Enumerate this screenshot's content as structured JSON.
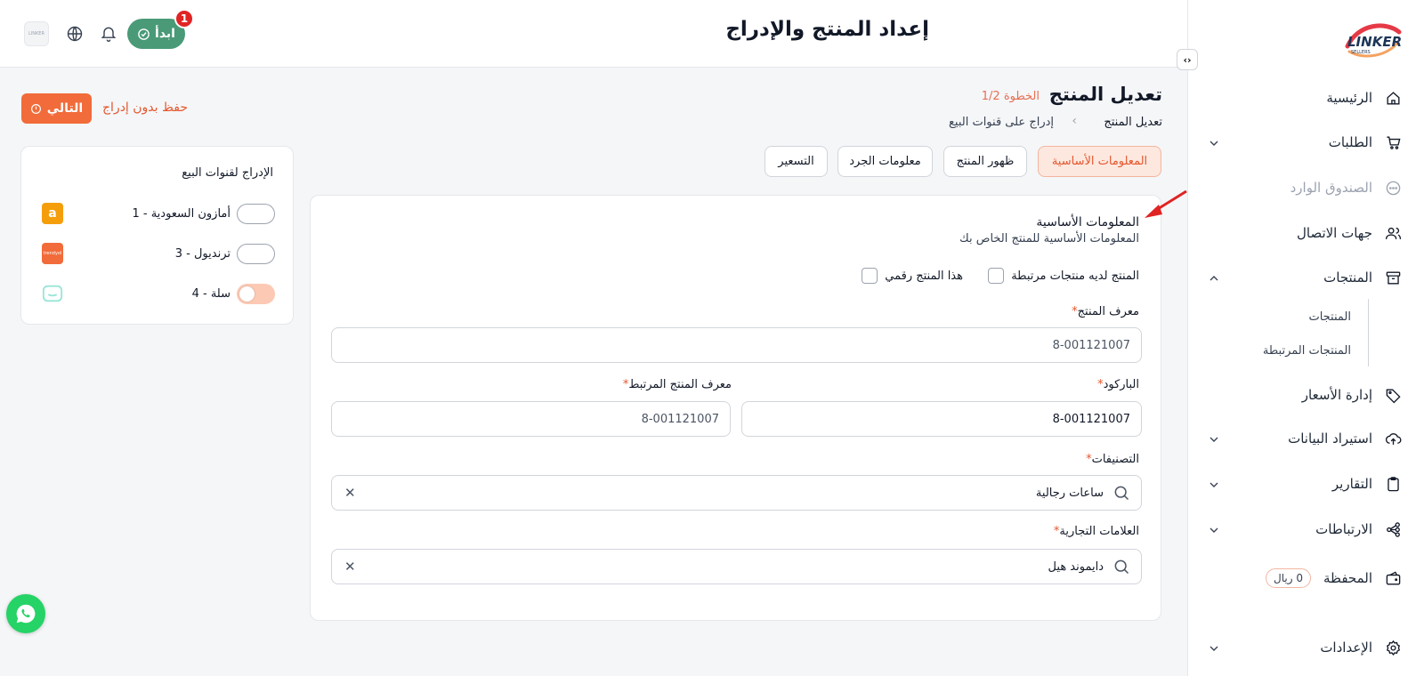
{
  "app": {
    "page_title": "إعداد المنتج والإدراج",
    "brand_mark": "LINKER SELLERS",
    "mini_logo_text": "LINKER"
  },
  "header": {
    "start_label": "ابدأ",
    "start_badge": "1",
    "colors": {
      "start": "#4a9a78",
      "badge": "#e02424"
    }
  },
  "sidebar": {
    "items": [
      {
        "label": "الرئيسية",
        "icon": "home-icon"
      },
      {
        "label": "الطلبات",
        "icon": "cart-icon"
      },
      {
        "label": "الصندوق الوارد",
        "icon": "chat-icon"
      },
      {
        "label": "جهات الاتصال",
        "icon": "users-icon"
      },
      {
        "label": "المنتجات",
        "icon": "box-icon"
      },
      {
        "label": "إدارة الأسعار",
        "icon": "tag-icon"
      },
      {
        "label": "استيراد البيانات",
        "icon": "upload-cloud-icon"
      },
      {
        "label": "التقارير",
        "icon": "clipboard-icon"
      },
      {
        "label": "الارتباطات",
        "icon": "share-icon"
      },
      {
        "label": "المحفظة",
        "icon": "wallet-icon"
      },
      {
        "label": "الإعدادات",
        "icon": "gear-icon"
      }
    ],
    "products_sub": [
      "المنتجات",
      "المنتجات المرتبطة"
    ],
    "wallet_badge": "0 ريال"
  },
  "subheader": {
    "title": "تعديل المنتج",
    "step": "الخطوة 1/2",
    "breadcrumb_current": "تعديل المنتج",
    "breadcrumb_next": "إدراج على قنوات البيع",
    "next_label": "التالي",
    "save_label": "حفظ بدون إدراج"
  },
  "tabs": [
    "المعلومات الأساسية",
    "ظهور المنتج",
    "معلومات الجرد",
    "التسعير"
  ],
  "form": {
    "section_title": "المعلومات الأساسية",
    "section_desc": "المعلومات الأساسية للمنتج الخاص بك",
    "check_related": "المنتج لديه منتجات مرتبطة",
    "check_digital": "هذا المنتج رقمي",
    "product_id_label": "معرف المنتج",
    "product_id_value": "8-001121007",
    "barcode_label": "الباركود",
    "barcode_value": "8-001121007",
    "linked_id_label": "معرف المنتج المرتبط",
    "linked_id_value": "8-001121007",
    "categories_label": "التصنيفات",
    "categories_value": "ساعات رجالية",
    "brands_label": "العلامات التجارية",
    "brands_value": "دايموند هيل",
    "required_mark": "*"
  },
  "channels": {
    "title": "الإدراج لقنوات البيع",
    "items": [
      {
        "label": "أمازون السعودية - 1",
        "enabled": false,
        "logo_text": "a",
        "color": "#f59e0b"
      },
      {
        "label": "ترنديول - 3",
        "enabled": false,
        "logo_text": "trendyol",
        "color": "#f26b3a"
      },
      {
        "label": "سلة - 4",
        "enabled": true,
        "logo_text": "",
        "color": "#99e6d8"
      }
    ]
  },
  "colors": {
    "accent": "#f26b3a",
    "active_tab_bg": "#fde8df",
    "active_tab_text": "#e4572e"
  }
}
